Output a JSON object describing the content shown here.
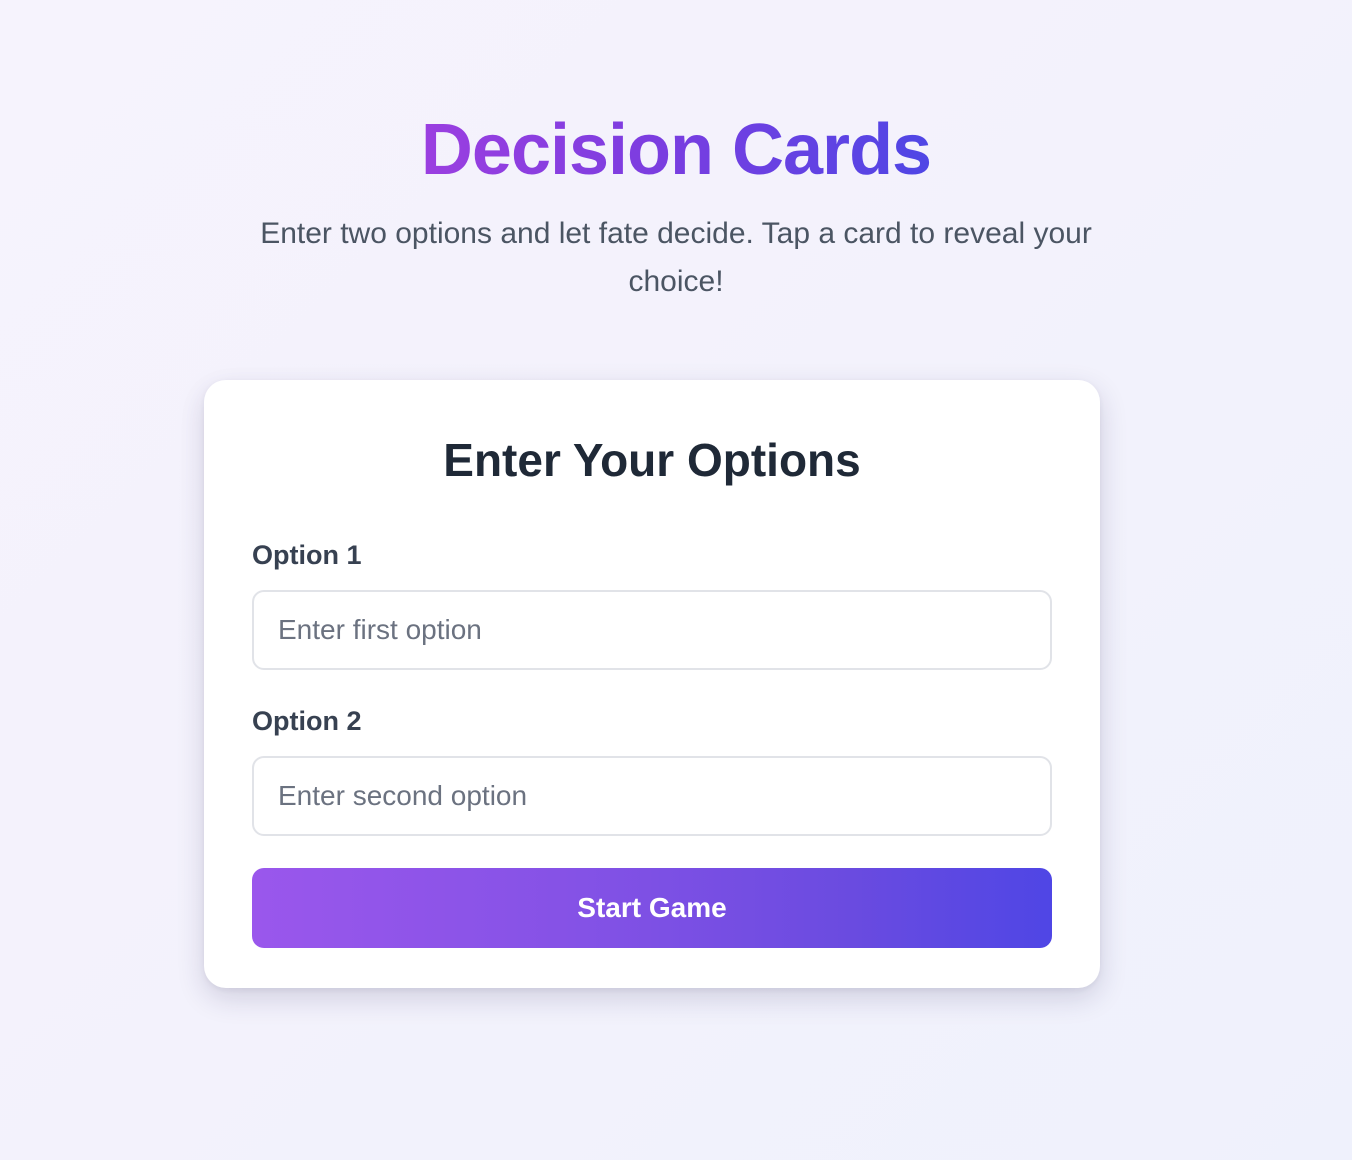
{
  "header": {
    "title": "Decision Cards",
    "subtitle": "Enter two options and let fate decide. Tap a card to reveal your choice!"
  },
  "form": {
    "title": "Enter Your Options",
    "option1": {
      "label": "Option 1",
      "value": "",
      "placeholder": "Enter first option"
    },
    "option2": {
      "label": "Option 2",
      "value": "",
      "placeholder": "Enter second option"
    },
    "start_button_label": "Start Game"
  },
  "colors": {
    "accent_start": "#9b3fe0",
    "accent_end": "#4f46e5",
    "background": "#f4f3fc",
    "text_primary": "#1f2937",
    "text_secondary": "#4b5563"
  }
}
